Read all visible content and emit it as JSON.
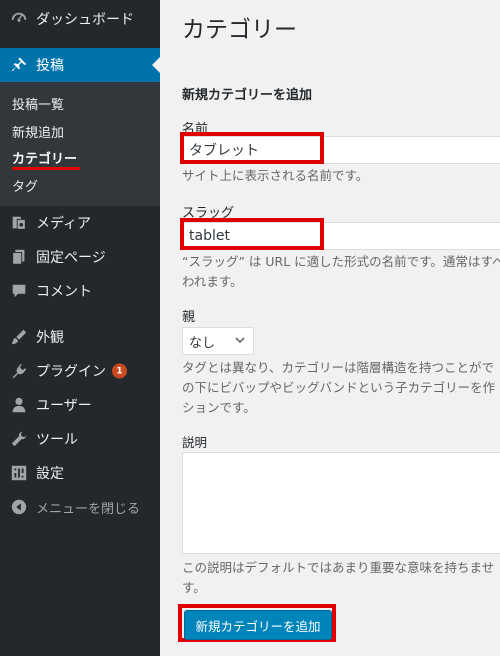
{
  "sidebar": {
    "dashboard": "ダッシュボード",
    "posts": "投稿",
    "submenu": {
      "all_posts": "投稿一覧",
      "add_new": "新規追加",
      "categories": "カテゴリー",
      "tags": "タグ"
    },
    "media": "メディア",
    "pages": "固定ページ",
    "comments": "コメント",
    "appearance": "外観",
    "plugins": "プラグイン",
    "plugins_badge": "1",
    "users": "ユーザー",
    "tools": "ツール",
    "settings": "設定",
    "collapse": "メニューを閉じる"
  },
  "main": {
    "title": "カテゴリー",
    "section_title": "新規カテゴリーを追加",
    "name_label": "名前",
    "name_value": "タブレット",
    "name_help": "サイト上に表示される名前です。",
    "slug_label": "スラッグ",
    "slug_value": "tablet",
    "slug_help_1": "“スラッグ” は URL に適した形式の名前です。通常はすべ",
    "slug_help_2": "われます。",
    "parent_label": "親",
    "parent_value": "なし",
    "parent_help_1": "タグとは異なり、カテゴリーは階層構造を持つことがで",
    "parent_help_2": "の下にビバップやビッグバンドという子カテゴリーを作",
    "parent_help_3": "ションです。",
    "description_label": "説明",
    "description_help_1": "この説明はデフォルトではあまり重要な意味を持ちませ",
    "description_help_2": "す。",
    "submit_label": "新規カテゴリーを追加"
  },
  "colors": {
    "sidebar_bg": "#23282d",
    "active_bg": "#0073aa",
    "highlight": "#e00000",
    "button": "#0085ba"
  }
}
